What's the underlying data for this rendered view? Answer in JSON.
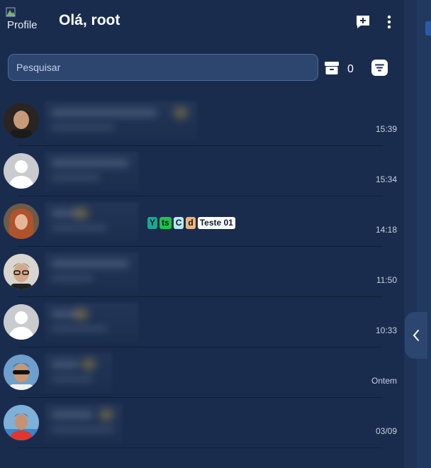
{
  "header": {
    "profile_alt": "Profile",
    "greeting": "Olá, root"
  },
  "search": {
    "placeholder": "Pesquisar"
  },
  "archive": {
    "count": "0"
  },
  "chats": [
    {
      "time": "15:39",
      "avatar": "photo"
    },
    {
      "time": "15:34",
      "avatar": "default"
    },
    {
      "time": "14:18",
      "avatar": "photo"
    },
    {
      "time": "11:50",
      "avatar": "photo"
    },
    {
      "time": "10:33",
      "avatar": "default"
    },
    {
      "time": "Ontem",
      "avatar": "photo"
    },
    {
      "time": "03/09",
      "avatar": "photo"
    }
  ],
  "tags": [
    {
      "label": "Y",
      "color": "#1aa893"
    },
    {
      "label": "ts",
      "color": "#1ec24a"
    },
    {
      "label": "C",
      "color": "#b8e6ef"
    },
    {
      "label": "d",
      "color": "#f0b47a"
    },
    {
      "label": "Teste 01",
      "color": "#ffffff"
    }
  ],
  "colors": {
    "background": "#1a2c4d",
    "search_bg": "#2c4670",
    "accent": "#2d5aa8"
  }
}
